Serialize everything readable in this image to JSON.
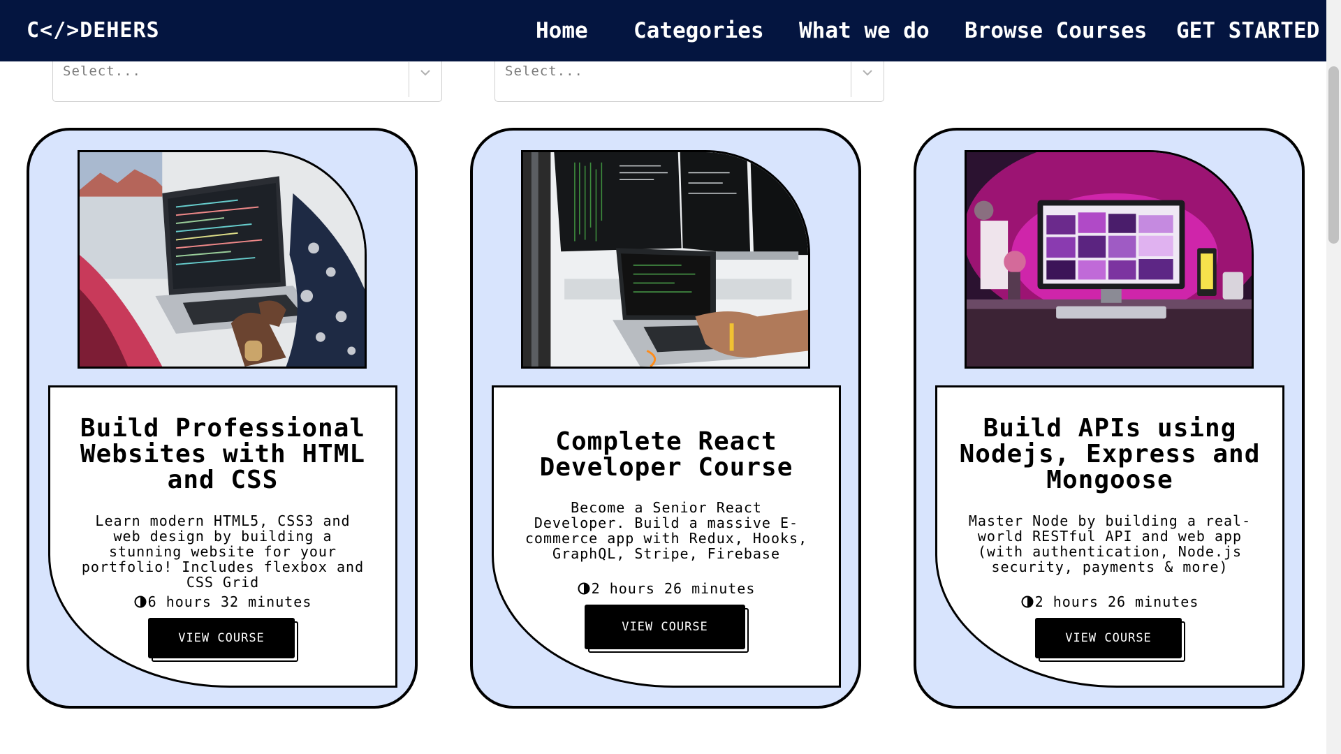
{
  "nav": {
    "logo": "C</>DEHERS",
    "items": [
      "Home",
      "Categories",
      "What we do",
      "Browse Courses",
      "GET STARTED"
    ]
  },
  "filters": [
    {
      "placeholder": "Select..."
    },
    {
      "placeholder": "Select..."
    }
  ],
  "cards": [
    {
      "title": "Build Professional Websites with HTML and CSS",
      "description": "Learn modern HTML5, CSS3 and web design by building a stunning website for your portfolio! Includes flexbox and CSS Grid",
      "duration": "6 hours 32 minutes",
      "button": "VIEW COURSE"
    },
    {
      "title": "Complete React Developer Course",
      "description": "Become a Senior React Developer. Build a massive E-commerce app with Redux, Hooks, GraphQL, Stripe, Firebase",
      "duration": "2 hours 26 minutes",
      "button": "VIEW COURSE"
    },
    {
      "title": "Build APIs using Nodejs, Express and Mongoose",
      "description": "Master Node by building a real-world RESTful API and web app (with authentication, Node.js security, payments & more)",
      "duration": "2 hours 26 minutes",
      "button": "VIEW COURSE"
    }
  ],
  "colors": {
    "nav_bg": "#041540",
    "card_bg": "#d8e4fd",
    "button_bg": "#000000"
  }
}
